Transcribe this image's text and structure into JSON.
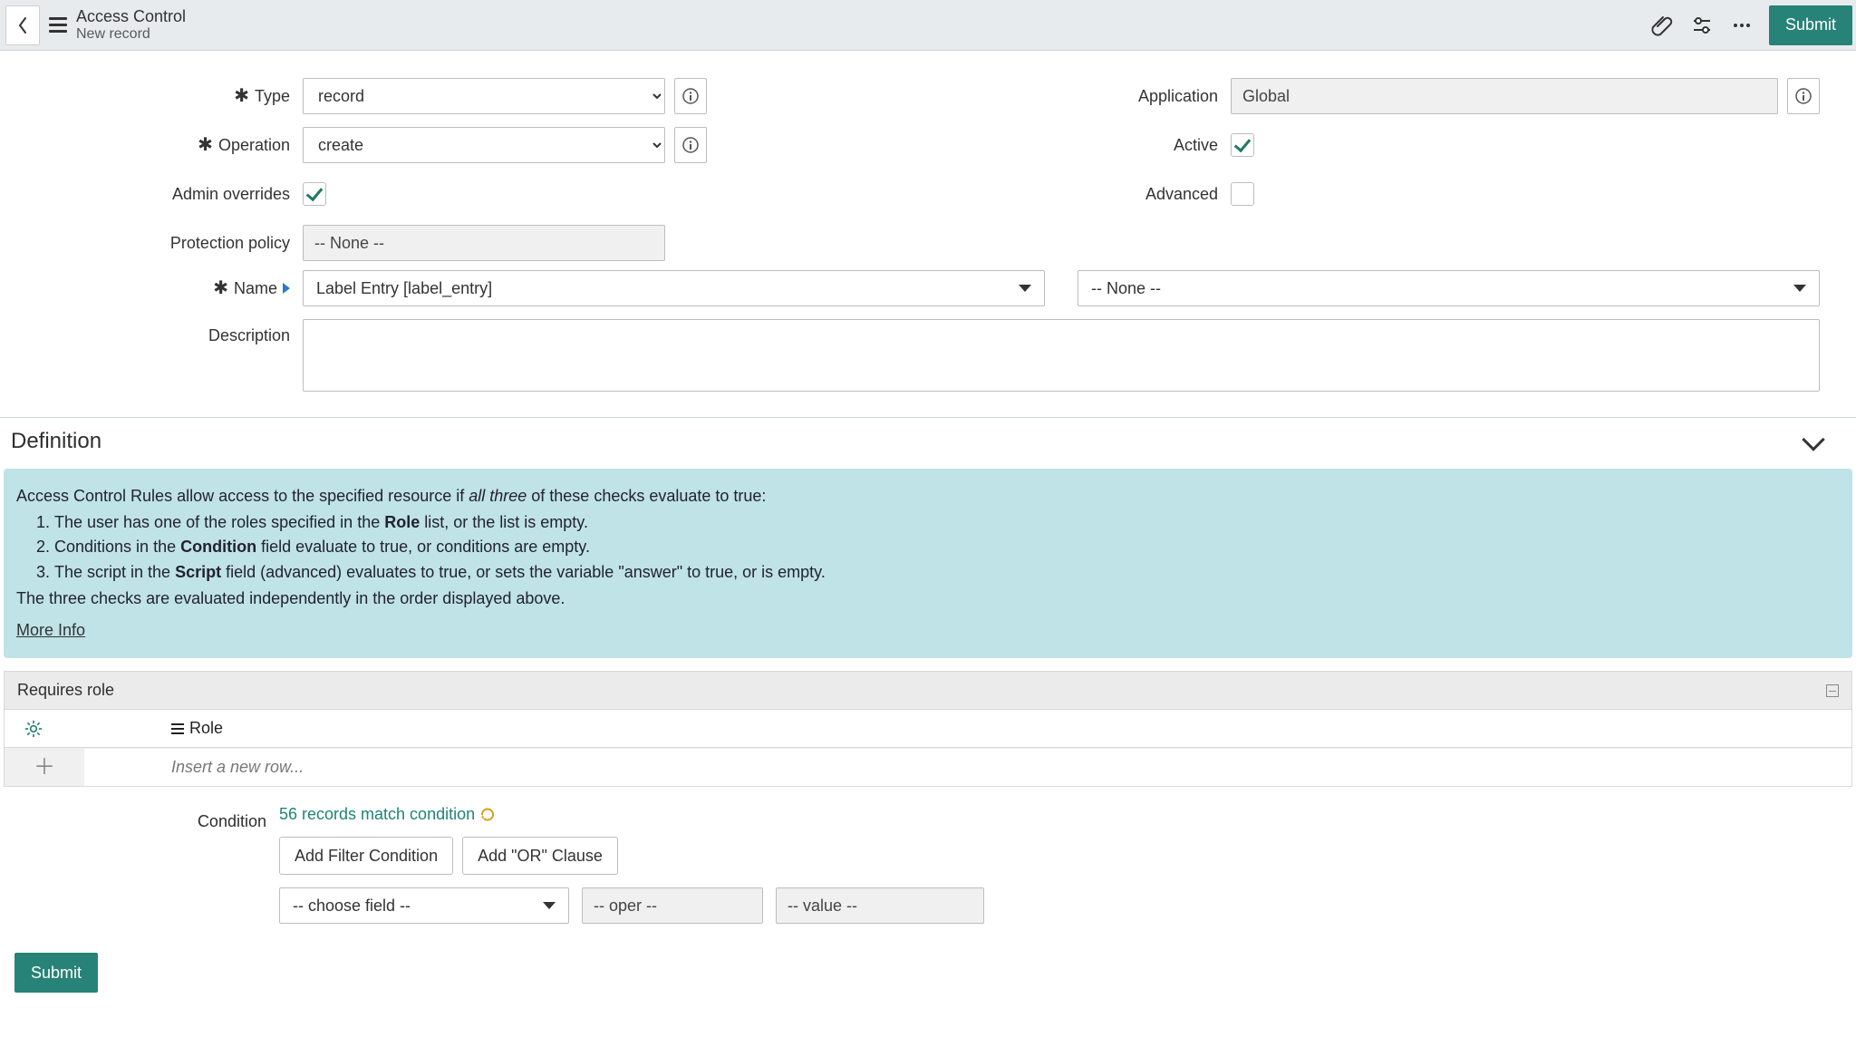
{
  "header": {
    "title": "Access Control",
    "subtitle": "New record",
    "submit": "Submit"
  },
  "form": {
    "type": {
      "label": "Type",
      "value": "record"
    },
    "operation": {
      "label": "Operation",
      "value": "create"
    },
    "admin_overrides": {
      "label": "Admin overrides",
      "checked": true
    },
    "protection_policy": {
      "label": "Protection policy",
      "value": "-- None --"
    },
    "application": {
      "label": "Application",
      "value": "Global"
    },
    "active": {
      "label": "Active",
      "checked": true
    },
    "advanced": {
      "label": "Advanced",
      "checked": false
    },
    "name": {
      "label": "Name",
      "table_value": "Label Entry [label_entry]",
      "field_value": "-- None --"
    },
    "description": {
      "label": "Description",
      "value": ""
    }
  },
  "definition": {
    "title": "Definition",
    "callout": {
      "intro_prefix": "Access Control Rules allow access to the specified resource if ",
      "intro_em": "all three",
      "intro_suffix": " of these checks evaluate to true:",
      "li1_pre": "The user has one of the roles specified in the ",
      "li1_b": "Role",
      "li1_post": " list, or the list is empty.",
      "li2_pre": "Conditions in the ",
      "li2_b": "Condition",
      "li2_post": " field evaluate to true, or conditions are empty.",
      "li3_pre": "The script in the ",
      "li3_b": "Script",
      "li3_post": " field (advanced) evaluates to true, or sets the variable \"answer\" to true, or is empty.",
      "outro": "The three checks are evaluated independently in the order displayed above.",
      "more_info": "More Info"
    },
    "requires_role": {
      "title": "Requires role",
      "column": "Role",
      "insert_placeholder": "Insert a new row..."
    },
    "condition": {
      "label": "Condition",
      "match_text": "56 records match condition",
      "add_filter": "Add Filter Condition",
      "add_or": "Add \"OR\" Clause",
      "choose_field": "-- choose field --",
      "oper": "-- oper --",
      "value": "-- value --"
    }
  },
  "bottom": {
    "submit": "Submit"
  }
}
